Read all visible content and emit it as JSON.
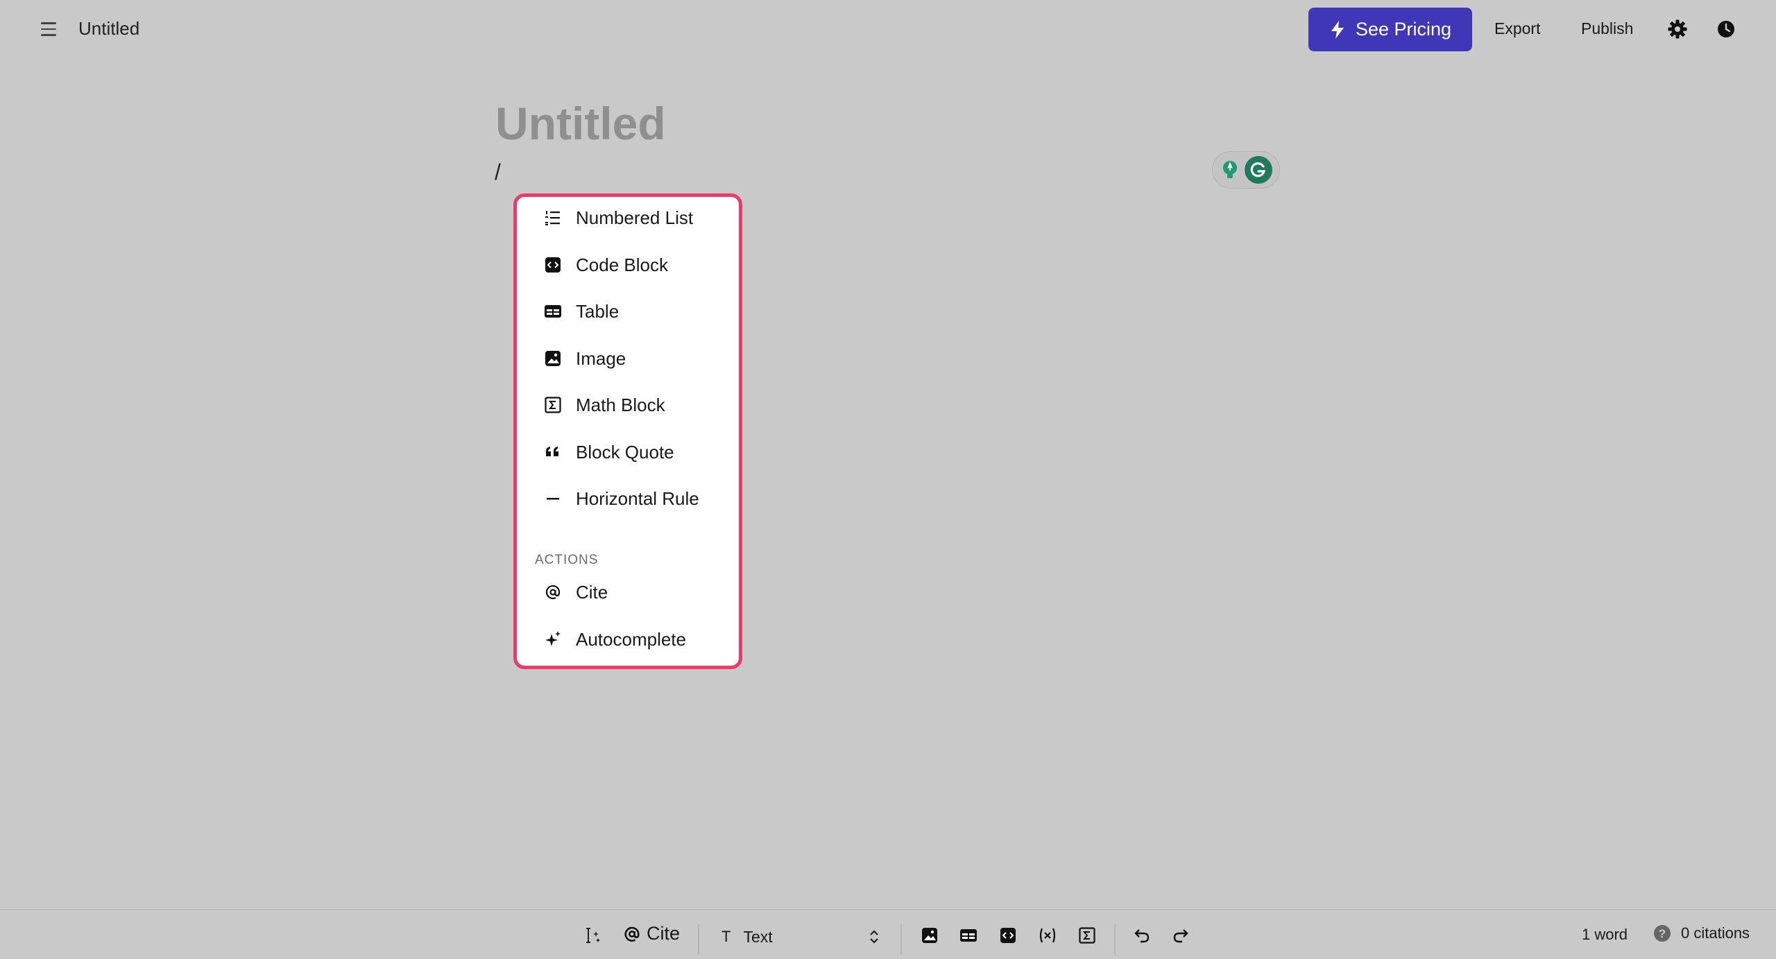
{
  "header": {
    "doc_title": "Untitled",
    "pricing_label": "See Pricing",
    "export_label": "Export",
    "publish_label": "Publish"
  },
  "editor": {
    "title_placeholder": "Untitled",
    "current_line": "/"
  },
  "slash_menu": {
    "items": [
      {
        "label": "Numbered List",
        "icon": "numbered-list-icon"
      },
      {
        "label": "Code Block",
        "icon": "code-block-icon"
      },
      {
        "label": "Table",
        "icon": "table-icon"
      },
      {
        "label": "Image",
        "icon": "image-icon"
      },
      {
        "label": "Math Block",
        "icon": "math-block-icon"
      },
      {
        "label": "Block Quote",
        "icon": "quote-icon"
      },
      {
        "label": "Horizontal Rule",
        "icon": "horizontal-rule-icon"
      }
    ],
    "actions_label": "ACTIONS",
    "actions": [
      {
        "label": "Cite",
        "icon": "at-icon"
      },
      {
        "label": "Autocomplete",
        "icon": "sparkle-icon"
      }
    ]
  },
  "bottombar": {
    "cite_label": "Cite",
    "text_style": "Text",
    "word_count": "1 word",
    "citations": "0 citations"
  },
  "colors": {
    "background": "#c9c9c9",
    "accent": "#3f36b8",
    "menu_border": "#ee3a6b",
    "grammarly": "#1f7a5a"
  }
}
